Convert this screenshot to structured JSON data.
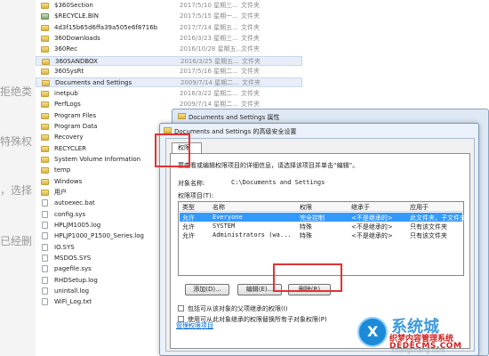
{
  "article": {
    "fragments": [
      {
        "text": "拒绝类"
      },
      {
        "text": "特殊权"
      },
      {
        "text": "，选择"
      },
      {
        "text": "已经删"
      }
    ]
  },
  "explorer": {
    "files": [
      {
        "name": "$360Section",
        "date": "2017/5/10 星期三...",
        "type": "文件夹",
        "icon": "folder"
      },
      {
        "name": "$RECYCLE.BIN",
        "date": "2017/5/15 星期一...",
        "type": "文件夹",
        "icon": "recycle"
      },
      {
        "name": "4d3f15b65d6ffa39a505e6f8716b",
        "date": "2017/7/14 星期五...",
        "type": "文件夹",
        "icon": "folder"
      },
      {
        "name": "360Downloads",
        "date": "2016/3/23 星期三...",
        "type": "文件夹",
        "icon": "folder"
      },
      {
        "name": "360Rec",
        "date": "2016/10/28 星期五...",
        "type": "文件夹",
        "icon": "folder"
      },
      {
        "name": "360SANDBOX",
        "date": "2016/3/25 星期五...",
        "type": "文件夹",
        "icon": "folder",
        "selected": true
      },
      {
        "name": "360SysRt",
        "date": "2017/5/16 星期二...",
        "type": "文件夹",
        "icon": "folder"
      },
      {
        "name": "Documents and Settings",
        "date": "2009/7/14 星期二...",
        "type": "文件夹",
        "icon": "folder",
        "selected": true
      },
      {
        "name": "inetpub",
        "date": "2016/3/22 星期二...",
        "type": "文件夹",
        "icon": "folder"
      },
      {
        "name": "PerfLogs",
        "date": "2009/7/14 星期二...",
        "type": "文件夹",
        "icon": "folder"
      },
      {
        "name": "Program Files",
        "date": "",
        "type": "",
        "icon": "folder"
      },
      {
        "name": "Program Data",
        "date": "",
        "type": "",
        "icon": "folder"
      },
      {
        "name": "Recovery",
        "date": "",
        "type": "",
        "icon": "folder"
      },
      {
        "name": "RECYCLER",
        "date": "",
        "type": "",
        "icon": "folder"
      },
      {
        "name": "System Volume Information",
        "date": "",
        "type": "",
        "icon": "folder"
      },
      {
        "name": "temp",
        "date": "",
        "type": "",
        "icon": "folder"
      },
      {
        "name": "Windows",
        "date": "",
        "type": "",
        "icon": "folder"
      },
      {
        "name": "用户",
        "date": "",
        "type": "",
        "icon": "folder"
      },
      {
        "name": "autoexec.bat",
        "date": "",
        "type": "",
        "icon": "file"
      },
      {
        "name": "config.sys",
        "date": "",
        "type": "",
        "icon": "file"
      },
      {
        "name": "HPLJM1005.log",
        "date": "",
        "type": "",
        "icon": "file"
      },
      {
        "name": "HPLJP1000_P1500_Series.log",
        "date": "",
        "type": "",
        "icon": "file"
      },
      {
        "name": "IO.SYS",
        "date": "",
        "type": "",
        "icon": "file"
      },
      {
        "name": "MSDOS.SYS",
        "date": "",
        "type": "",
        "icon": "file"
      },
      {
        "name": "pagefile.sys",
        "date": "",
        "type": "",
        "icon": "file"
      },
      {
        "name": "RHDSetup.log",
        "date": "",
        "type": "",
        "icon": "file"
      },
      {
        "name": "unintall.log",
        "date": "",
        "type": "",
        "icon": "file"
      },
      {
        "name": "WiFi_Log.txt",
        "date": "",
        "type": "",
        "icon": "file"
      }
    ]
  },
  "properties_window": {
    "title": "Documents and Settings 属性"
  },
  "advanced_dialog": {
    "title": "Documents and Settings 的高级安全设置",
    "tab_label": "权限",
    "hint": "要查看或编辑权限项目的详细信息，请选择该项目并单击“编辑”。",
    "object_label": "对象名称:",
    "object_value": "C:\\Documents and Settings",
    "entries_label": "权限项目(T):",
    "columns": [
      "类型",
      "名称",
      "权限",
      "继承于",
      "应用于"
    ],
    "rows": [
      {
        "type": "允许",
        "name": "Everyone",
        "perm": "完全控制",
        "inherit": "<不是继承的>",
        "apply": "此文件夹，子文件夹...",
        "selected": true
      },
      {
        "type": "允许",
        "name": "SYSTEM",
        "perm": "特殊",
        "inherit": "<不是继承的>",
        "apply": "只有该文件夹"
      },
      {
        "type": "允许",
        "name": "Administrators (wa...",
        "perm": "特殊",
        "inherit": "<不是继承的>",
        "apply": "只有该文件夹"
      }
    ],
    "buttons": {
      "add": "添加(D)...",
      "edit": "编辑(E)...",
      "remove": "删除(R)"
    },
    "checkbox_inherit": "包括可从该对象的父项继承的权限(I)",
    "checkbox_replace": "使用可从此对象继承的权限替换所有子对象权限(P)",
    "link": "管理权限项目"
  },
  "watermark": {
    "big": "系统城",
    "cn": "织梦内容管理系统",
    "url": "DEDECMS.COM",
    "small": "xitongcheng.com"
  },
  "colors": {
    "highlight_red": "#e03333",
    "selection_blue": "#3399ff",
    "link_blue": "#0066cc"
  }
}
